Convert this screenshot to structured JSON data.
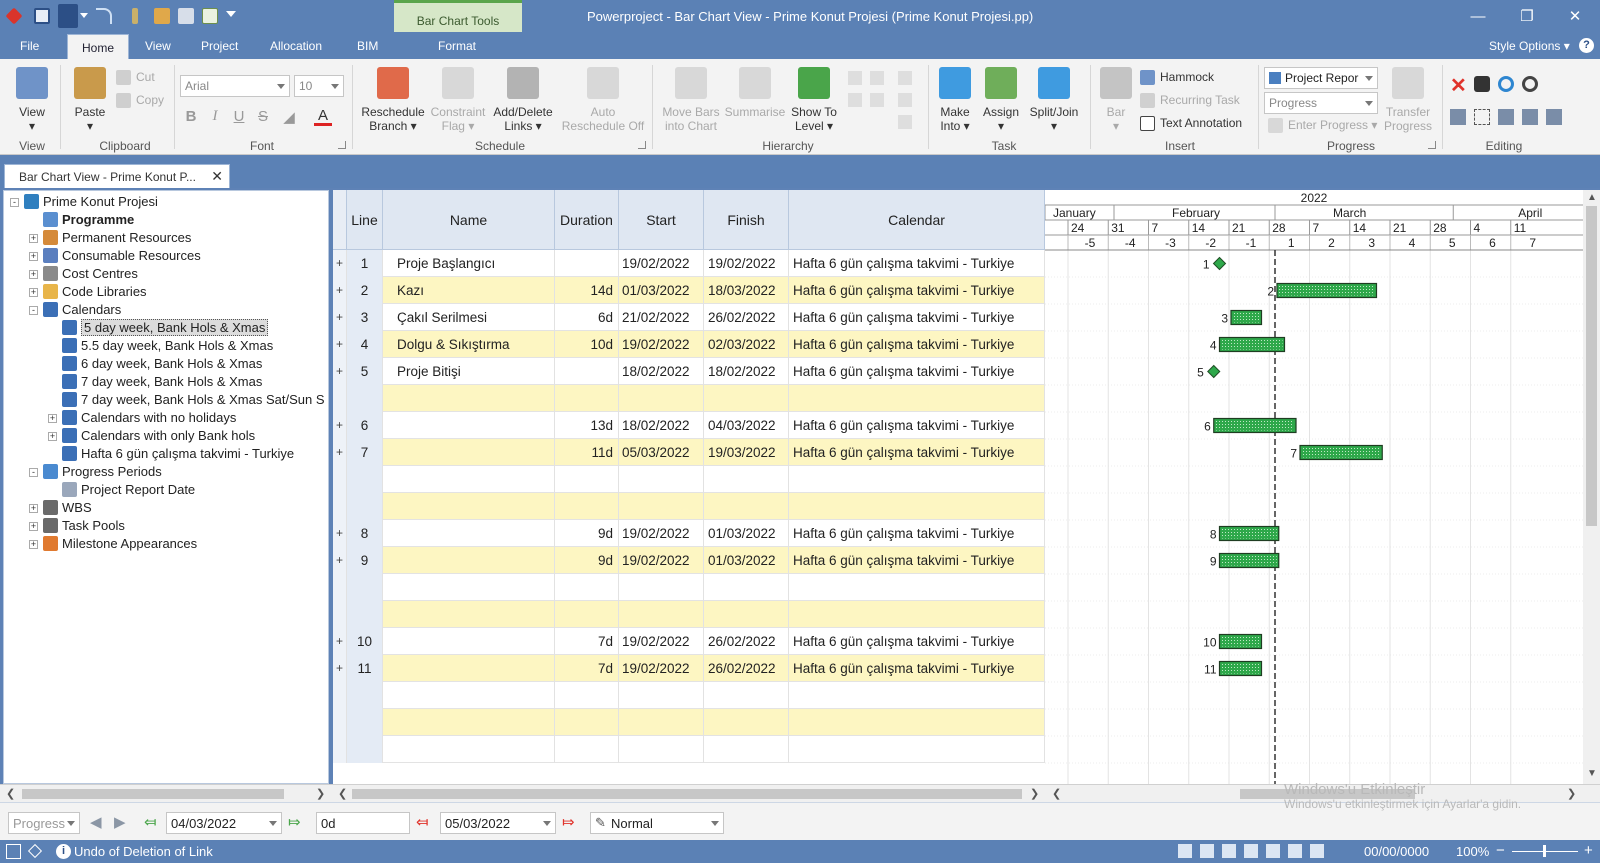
{
  "window": {
    "title": "Powerproject - Bar Chart View - Prime Konut Projesi (Prime Konut Projesi.pp)",
    "context_tab": "Bar Chart Tools"
  },
  "ribbon_tabs": [
    "File",
    "Home",
    "View",
    "Project",
    "Allocation",
    "BIM",
    "Format"
  ],
  "style_options": "Style Options",
  "ribbon": {
    "view": {
      "label": "View",
      "group": "View"
    },
    "clipboard": {
      "paste": "Paste",
      "cut": "Cut",
      "copy": "Copy",
      "group": "Clipboard"
    },
    "font": {
      "family": "Arial",
      "size": "10",
      "group": "Font"
    },
    "schedule": {
      "reschedule": [
        "Reschedule",
        "Branch"
      ],
      "constraint": [
        "Constraint",
        "Flag"
      ],
      "links": [
        "Add/Delete",
        "Links"
      ],
      "auto": [
        "Auto",
        "Reschedule Off"
      ],
      "group": "Schedule"
    },
    "hierarchy": {
      "move": [
        "Move Bars",
        "into Chart"
      ],
      "summarise": "Summarise",
      "show_to": [
        "Show To",
        "Level"
      ],
      "group": "Hierarchy"
    },
    "task": {
      "make": [
        "Make",
        "Into"
      ],
      "assign": "Assign",
      "split": "Split/Join",
      "group": "Task"
    },
    "insert": {
      "bar": "Bar",
      "hammock": "Hammock",
      "recurring": "Recurring Task",
      "text_annotation": "Text Annotation",
      "group": "Insert"
    },
    "progress": {
      "report": "Project Repor",
      "mode": "Progress",
      "enter": "Enter Progress",
      "transfer": [
        "Transfer",
        "Progress"
      ],
      "group": "Progress"
    },
    "editing": {
      "group": "Editing"
    }
  },
  "doc_tab": "Bar Chart View - Prime Konut P...",
  "tree": [
    {
      "label": "Prime Konut Projesi",
      "level": 0,
      "icon": "globe-icon",
      "color": "#2f7fbf",
      "expander": "-"
    },
    {
      "label": "Programme",
      "level": 1,
      "icon": "programme-icon",
      "color": "#5a8fd0",
      "bold": true
    },
    {
      "label": "Permanent Resources",
      "level": 1,
      "icon": "person-icon",
      "color": "#d58a3a",
      "expander": "+"
    },
    {
      "label": "Consumable Resources",
      "level": 1,
      "icon": "consumable-icon",
      "color": "#5b7fbf",
      "expander": "+"
    },
    {
      "label": "Cost Centres",
      "level": 1,
      "icon": "cost-centre-icon",
      "color": "#8a8a8a",
      "expander": "+"
    },
    {
      "label": "Code Libraries",
      "level": 1,
      "icon": "folder-icon",
      "color": "#e8b54a",
      "expander": "+"
    },
    {
      "label": "Calendars",
      "level": 1,
      "icon": "calendar-icon",
      "color": "#3b6fb6",
      "expander": "-"
    },
    {
      "label": "5 day week, Bank Hols & Xmas",
      "level": 2,
      "icon": "calendar-icon",
      "color": "#3b6fb6",
      "selected": true
    },
    {
      "label": "5.5 day week, Bank Hols &  Xmas",
      "level": 2,
      "icon": "calendar-icon",
      "color": "#3b6fb6"
    },
    {
      "label": "6 day week, Bank Hols & Xmas",
      "level": 2,
      "icon": "calendar-icon",
      "color": "#3b6fb6"
    },
    {
      "label": "7 day week, Bank Hols & Xmas",
      "level": 2,
      "icon": "calendar-icon",
      "color": "#3b6fb6"
    },
    {
      "label": "7 day week, Bank Hols & Xmas Sat/Sun S",
      "level": 2,
      "icon": "calendar-icon",
      "color": "#3b6fb6"
    },
    {
      "label": "Calendars with no holidays",
      "level": 2,
      "icon": "calendar-icon",
      "color": "#3b6fb6",
      "expander": "+"
    },
    {
      "label": "Calendars with only Bank hols",
      "level": 2,
      "icon": "calendar-icon",
      "color": "#3b6fb6",
      "expander": "+"
    },
    {
      "label": "Hafta 6 gün çalışma takvimi - Turkiye",
      "level": 2,
      "icon": "calendar-edit-icon",
      "color": "#3b6fb6"
    },
    {
      "label": "Progress Periods",
      "level": 1,
      "icon": "progress-periods-icon",
      "color": "#4a8ad0",
      "expander": "-"
    },
    {
      "label": "Project Report Date",
      "level": 2,
      "icon": "report-date-icon",
      "color": "#9aa7bb"
    },
    {
      "label": "WBS",
      "level": 1,
      "icon": "wbs-icon",
      "color": "#6a6a6a",
      "expander": "+"
    },
    {
      "label": "Task Pools",
      "level": 1,
      "icon": "task-pool-icon",
      "color": "#6a6a6a",
      "expander": "+"
    },
    {
      "label": "Milestone Appearances",
      "level": 1,
      "icon": "milestone-icon",
      "color": "#e07a30",
      "expander": "+"
    }
  ],
  "grid": {
    "headers": {
      "line": "Line",
      "name": "Name",
      "duration": "Duration",
      "start": "Start",
      "finish": "Finish",
      "calendar": "Calendar"
    },
    "rows": [
      {
        "plus": "+",
        "line": "1",
        "name": "Proje Başlangıcı",
        "duration": "",
        "start": "19/02/2022",
        "finish": "19/02/2022",
        "calendar": "Hafta 6 gün çalışma takvimi - Turkiye"
      },
      {
        "plus": "+",
        "line": "2",
        "name": "Kazı",
        "duration": "14d",
        "start": "01/03/2022",
        "finish": "18/03/2022",
        "calendar": "Hafta 6 gün çalışma takvimi - Turkiye"
      },
      {
        "plus": "+",
        "line": "3",
        "name": "Çakıl Serilmesi",
        "duration": "6d",
        "start": "21/02/2022",
        "finish": "26/02/2022",
        "calendar": "Hafta 6 gün çalışma takvimi - Turkiye"
      },
      {
        "plus": "+",
        "line": "4",
        "name": "Dolgu & Sıkıştırma",
        "duration": "10d",
        "start": "19/02/2022",
        "finish": "02/03/2022",
        "calendar": "Hafta 6 gün çalışma takvimi - Turkiye"
      },
      {
        "plus": "+",
        "line": "5",
        "name": "Proje Bitişi",
        "duration": "",
        "start": "18/02/2022",
        "finish": "18/02/2022",
        "calendar": "Hafta 6 gün çalışma takvimi - Turkiye"
      },
      {
        "plus": "",
        "line": "",
        "name": "",
        "duration": "",
        "start": "",
        "finish": "",
        "calendar": ""
      },
      {
        "plus": "+",
        "line": "6",
        "name": "",
        "duration": "13d",
        "start": "18/02/2022",
        "finish": "04/03/2022",
        "calendar": "Hafta 6 gün çalışma takvimi - Turkiye"
      },
      {
        "plus": "+",
        "line": "7",
        "name": "",
        "duration": "11d",
        "start": "05/03/2022",
        "finish": "19/03/2022",
        "calendar": "Hafta 6 gün çalışma takvimi - Turkiye"
      },
      {
        "plus": "",
        "line": "",
        "name": "",
        "duration": "",
        "start": "",
        "finish": "",
        "calendar": ""
      },
      {
        "plus": "",
        "line": "",
        "name": "",
        "duration": "",
        "start": "",
        "finish": "",
        "calendar": ""
      },
      {
        "plus": "+",
        "line": "8",
        "name": "",
        "duration": "9d",
        "start": "19/02/2022",
        "finish": "01/03/2022",
        "calendar": "Hafta 6 gün çalışma takvimi - Turkiye"
      },
      {
        "plus": "+",
        "line": "9",
        "name": "",
        "duration": "9d",
        "start": "19/02/2022",
        "finish": "01/03/2022",
        "calendar": "Hafta 6 gün çalışma takvimi - Turkiye"
      },
      {
        "plus": "",
        "line": "",
        "name": "",
        "duration": "",
        "start": "",
        "finish": "",
        "calendar": ""
      },
      {
        "plus": "",
        "line": "",
        "name": "",
        "duration": "",
        "start": "",
        "finish": "",
        "calendar": ""
      },
      {
        "plus": "+",
        "line": "10",
        "name": "",
        "duration": "7d",
        "start": "19/02/2022",
        "finish": "26/02/2022",
        "calendar": "Hafta 6 gün çalışma takvimi - Turkiye"
      },
      {
        "plus": "+",
        "line": "11",
        "name": "",
        "duration": "7d",
        "start": "19/02/2022",
        "finish": "26/02/2022",
        "calendar": "Hafta 6 gün çalışma takvimi - Turkiye"
      },
      {
        "plus": "",
        "line": "",
        "name": "",
        "duration": "",
        "start": "",
        "finish": "",
        "calendar": ""
      },
      {
        "plus": "",
        "line": "",
        "name": "",
        "duration": "",
        "start": "",
        "finish": "",
        "calendar": ""
      },
      {
        "plus": "",
        "line": "",
        "name": "",
        "duration": "",
        "start": "",
        "finish": "",
        "calendar": ""
      }
    ]
  },
  "timescale": {
    "year": "2022",
    "months": [
      "January",
      "February",
      "March",
      "April"
    ],
    "days": [
      "24",
      "31",
      "7",
      "14",
      "21",
      "28",
      "7",
      "14",
      "21",
      "28",
      "4",
      "11"
    ],
    "weeks": [
      "-5",
      "-4",
      "-3",
      "-2",
      "-1",
      "1",
      "2",
      "3",
      "4",
      "5",
      "6",
      "7"
    ],
    "report_date": "2022-03-01"
  },
  "bars": [
    {
      "line": "1",
      "type": "milestone",
      "start": "2022-02-19"
    },
    {
      "line": "2",
      "type": "task",
      "start": "2022-03-01",
      "finish": "2022-03-18"
    },
    {
      "line": "3",
      "type": "task",
      "start": "2022-02-21",
      "finish": "2022-02-26"
    },
    {
      "line": "4",
      "type": "task",
      "start": "2022-02-19",
      "finish": "2022-03-02"
    },
    {
      "line": "5",
      "type": "milestone",
      "start": "2022-02-18"
    },
    {
      "line": "6",
      "type": "task",
      "start": "2022-02-18",
      "finish": "2022-03-04"
    },
    {
      "line": "7",
      "type": "task",
      "start": "2022-03-05",
      "finish": "2022-03-19"
    },
    {
      "line": "8",
      "type": "task",
      "start": "2022-02-19",
      "finish": "2022-03-01"
    },
    {
      "line": "9",
      "type": "task",
      "start": "2022-02-19",
      "finish": "2022-03-01"
    },
    {
      "line": "10",
      "type": "task",
      "start": "2022-02-19",
      "finish": "2022-02-26"
    },
    {
      "line": "11",
      "type": "task",
      "start": "2022-02-19",
      "finish": "2022-02-26"
    }
  ],
  "bottom_toolbar": {
    "mode": "Progress",
    "date1": "04/03/2022",
    "duration": "0d",
    "date2": "05/03/2022",
    "view_style": "Normal"
  },
  "watermark": {
    "title": "Windows'u Etkinleştir",
    "subtitle": "Windows'u etkinleştirmek için Ayarlar'a gidin."
  },
  "status": {
    "message": "Undo of Deletion of Link",
    "date": "00/00/0000",
    "zoom": "100%"
  },
  "colors": {
    "accent": "#5b81b5",
    "bar_fill": "#2ea84a",
    "highlight_row": "#fdf6c2"
  }
}
